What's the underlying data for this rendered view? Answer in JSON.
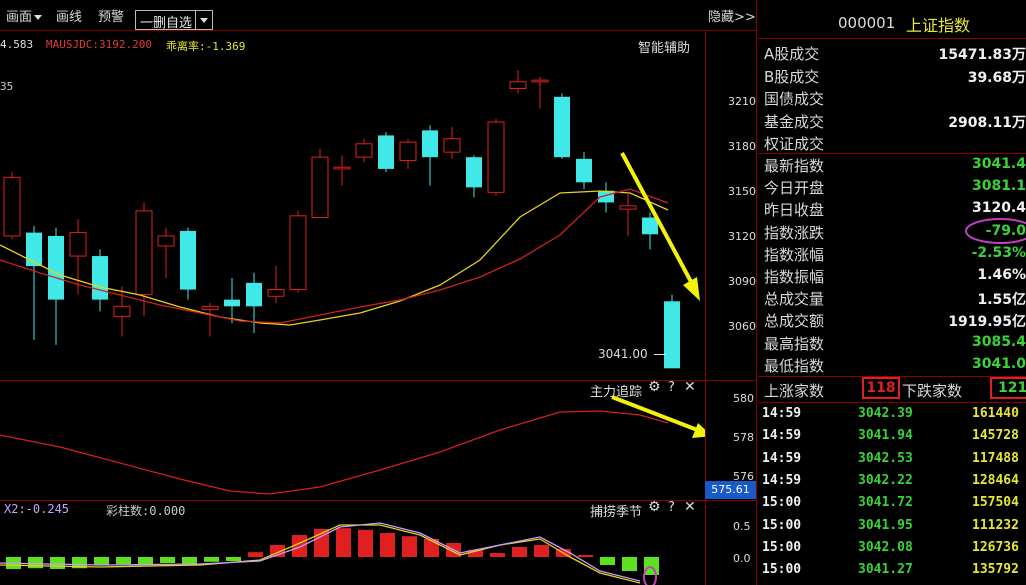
{
  "toolbar": {
    "items": [
      "画面",
      "画线",
      "预警"
    ],
    "selection_label": "一删自选",
    "hide_label": "隐藏>>"
  },
  "info_line": {
    "left_value": "4.583",
    "ma_label": "MAUSJDC:3192.200",
    "deviation_label": "乖离率:-1.369",
    "assist_label": "智能辅助",
    "fragment_left": "35"
  },
  "main_axis": [
    "3210",
    "3180",
    "3150",
    "3120",
    "3090",
    "3060"
  ],
  "last_price_label": "3041.00",
  "sub1": {
    "title": "主力追踪",
    "axis": [
      "580",
      "578",
      "576"
    ],
    "current_value": "575.61",
    "icons": [
      "gear-icon",
      "help-icon",
      "close-icon"
    ]
  },
  "sub2": {
    "left_label": "X2:-0.245",
    "bar_label": "彩柱数:0.000",
    "title": "捕捞季节",
    "axis": [
      "0.5",
      "0.0"
    ],
    "icons": [
      "gear-icon",
      "help-icon",
      "close-icon"
    ]
  },
  "panel": {
    "code": "000001",
    "name": "上证指数",
    "volume_rows": [
      {
        "label": "A股成交",
        "value": "15471.83万"
      },
      {
        "label": "B股成交",
        "value": "39.68万"
      },
      {
        "label": "国债成交",
        "value": ""
      },
      {
        "label": "基金成交",
        "value": "2908.11万"
      },
      {
        "label": "权证成交",
        "value": ""
      }
    ],
    "index_rows": [
      {
        "label": "最新指数",
        "value": "3041.4",
        "color": "#3ad13a"
      },
      {
        "label": "今日开盘",
        "value": "3081.1",
        "color": "#3ad13a"
      },
      {
        "label": "昨日收盘",
        "value": "3120.4",
        "color": "#f0f0f0"
      },
      {
        "label": "指数涨跌",
        "value": "-79.0",
        "color": "#3ad13a"
      },
      {
        "label": "指数涨幅",
        "value": "-2.53%",
        "color": "#3ad13a"
      },
      {
        "label": "指数振幅",
        "value": "1.46%",
        "color": "#f0f0f0"
      },
      {
        "label": "总成交量",
        "value": "1.55亿",
        "color": "#f0f0f0"
      },
      {
        "label": "总成交额",
        "value": "1919.95亿",
        "color": "#f0f0f0"
      },
      {
        "label": "最高指数",
        "value": "3085.4",
        "color": "#3ad13a"
      },
      {
        "label": "最低指数",
        "value": "3041.0",
        "color": "#3ad13a"
      }
    ],
    "up_label": "上涨家数",
    "up_count": "118",
    "down_label": "下跌家数",
    "down_count": "121",
    "trades": [
      {
        "time": "14:59",
        "price": "3042.39",
        "vol": "161440"
      },
      {
        "time": "14:59",
        "price": "3041.94",
        "vol": "145728"
      },
      {
        "time": "14:59",
        "price": "3042.53",
        "vol": "117488"
      },
      {
        "time": "14:59",
        "price": "3042.22",
        "vol": "128464"
      },
      {
        "time": "15:00",
        "price": "3041.72",
        "vol": "157504"
      },
      {
        "time": "15:00",
        "price": "3041.95",
        "vol": "111232"
      },
      {
        "time": "15:00",
        "price": "3042.08",
        "vol": "126736"
      },
      {
        "time": "15:00",
        "price": "3041.27",
        "vol": "135792"
      }
    ]
  },
  "chart_data": {
    "type": "candlestick",
    "ylim": [
      3040,
      3225
    ],
    "axis_ticks": [
      3210,
      3180,
      3150,
      3120,
      3090,
      3060
    ],
    "candles": [
      {
        "o": 3120,
        "c": 3155,
        "h": 3158,
        "l": 3118
      },
      {
        "o": 3122,
        "c": 3102,
        "h": 3126,
        "l": 3058
      },
      {
        "o": 3120,
        "c": 3082,
        "h": 3125,
        "l": 3055
      },
      {
        "o": 3108,
        "c": 3122,
        "h": 3130,
        "l": 3085
      },
      {
        "o": 3108,
        "c": 3082,
        "h": 3112,
        "l": 3075
      },
      {
        "o": 3072,
        "c": 3078,
        "h": 3090,
        "l": 3060
      },
      {
        "o": 3085,
        "c": 3135,
        "h": 3140,
        "l": 3072
      },
      {
        "o": 3114,
        "c": 3120,
        "h": 3125,
        "l": 3095
      },
      {
        "o": 3123,
        "c": 3088,
        "h": 3125,
        "l": 3082
      },
      {
        "o": 3076,
        "c": 3078,
        "h": 3080,
        "l": 3060
      },
      {
        "o": 3082,
        "c": 3078,
        "h": 3095,
        "l": 3068
      },
      {
        "o": 3092,
        "c": 3078,
        "h": 3098,
        "l": 3062
      },
      {
        "o": 3084,
        "c": 3088,
        "h": 3102,
        "l": 3080
      },
      {
        "o": 3088,
        "c": 3132,
        "h": 3135,
        "l": 3086
      },
      {
        "o": 3131,
        "c": 3167,
        "h": 3172,
        "l": 3131
      },
      {
        "o": 3160,
        "c": 3161,
        "h": 3168,
        "l": 3150
      },
      {
        "o": 3167,
        "c": 3175,
        "h": 3178,
        "l": 3164
      },
      {
        "o": 3180,
        "c": 3160,
        "h": 3182,
        "l": 3158
      },
      {
        "o": 3165,
        "c": 3176,
        "h": 3178,
        "l": 3160
      },
      {
        "o": 3183,
        "c": 3167,
        "h": 3186,
        "l": 3150
      },
      {
        "o": 3170,
        "c": 3178,
        "h": 3185,
        "l": 3166
      },
      {
        "o": 3167,
        "c": 3149,
        "h": 3168,
        "l": 3143
      },
      {
        "o": 3146,
        "c": 3188,
        "h": 3190,
        "l": 3144
      },
      {
        "o": 3208,
        "c": 3212,
        "h": 3219,
        "l": 3205
      },
      {
        "o": 3212,
        "c": 3213,
        "h": 3215,
        "l": 3196
      },
      {
        "o": 3203,
        "c": 3167,
        "h": 3205,
        "l": 3166
      },
      {
        "o": 3166,
        "c": 3152,
        "h": 3170,
        "l": 3148
      },
      {
        "o": 3147,
        "c": 3140,
        "h": 3152,
        "l": 3134
      },
      {
        "o": 3136,
        "c": 3138,
        "h": 3145,
        "l": 3120
      },
      {
        "o": 3131,
        "c": 3121,
        "h": 3134,
        "l": 3112
      },
      {
        "o": 3081,
        "c": 3041,
        "h": 3085,
        "l": 3041
      }
    ]
  }
}
